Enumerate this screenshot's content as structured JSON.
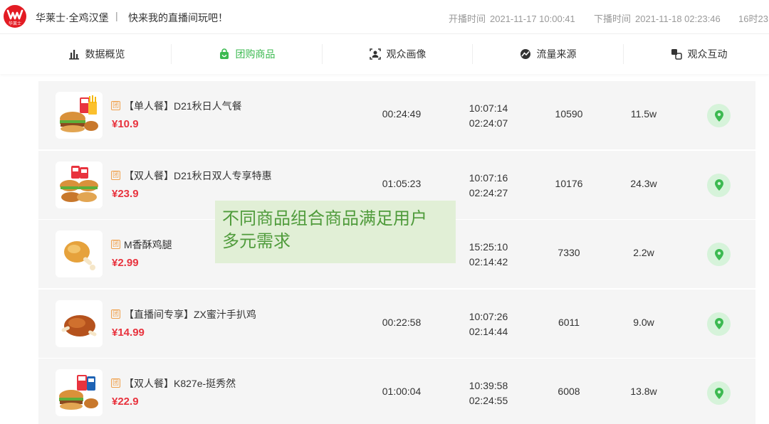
{
  "header": {
    "logo_text": "华莱士",
    "shop_name": "华莱士·全鸡汉堡",
    "separator": "|",
    "slogan": "快来我的直播间玩吧！",
    "start_label": "开播时间",
    "start_time": "2021-11-17 10:00:41",
    "end_label": "下播时间",
    "end_time": "2021-11-18 02:23:46",
    "duration": "16时23"
  },
  "tabs": [
    {
      "label": "数据概览",
      "icon": "bar-chart-icon",
      "active": false
    },
    {
      "label": "团购商品",
      "icon": "shopping-bag-icon",
      "active": true
    },
    {
      "label": "观众画像",
      "icon": "user-portrait-icon",
      "active": false
    },
    {
      "label": "流量来源",
      "icon": "traffic-source-icon",
      "active": false
    },
    {
      "label": "观众互动",
      "icon": "interaction-icon",
      "active": false
    }
  ],
  "tag_label": "团",
  "products": [
    {
      "name": "【单人餐】D21秋日人气餐",
      "price": "¥10.9",
      "duration": "00:24:49",
      "time_start": "10:07:14",
      "time_end": "02:24:07",
      "sales": "10590",
      "views": "11.5w",
      "image": "burger-combo"
    },
    {
      "name": "【双人餐】D21秋日双人专享特惠",
      "price": "¥23.9",
      "duration": "01:05:23",
      "time_start": "10:07:16",
      "time_end": "02:24:27",
      "sales": "10176",
      "views": "24.3w",
      "image": "double-combo"
    },
    {
      "name": "M香酥鸡腿",
      "price": "¥2.99",
      "duration": "",
      "time_start": "15:25:10",
      "time_end": "02:14:42",
      "sales": "7330",
      "views": "2.2w",
      "image": "chicken-leg"
    },
    {
      "name": "【直播间专享】ZX蜜汁手扒鸡",
      "price": "¥14.99",
      "duration": "00:22:58",
      "time_start": "10:07:26",
      "time_end": "02:14:44",
      "sales": "6011",
      "views": "9.0w",
      "image": "roast-chicken"
    },
    {
      "name": "【双人餐】K827e-挺秀然",
      "price": "¥22.9",
      "duration": "01:00:04",
      "time_start": "10:39:58",
      "time_end": "02:24:55",
      "sales": "6008",
      "views": "13.8w",
      "image": "burger-combo"
    }
  ],
  "overlay": {
    "line1": "不同商品组合商品满足用户",
    "line2": "多元需求"
  },
  "colors": {
    "accent_green": "#3cba51",
    "price_red": "#e8333e",
    "tag_orange": "#f0a04b",
    "row_bg": "#f5f5f5",
    "overlay_text": "#4f9b3b"
  }
}
